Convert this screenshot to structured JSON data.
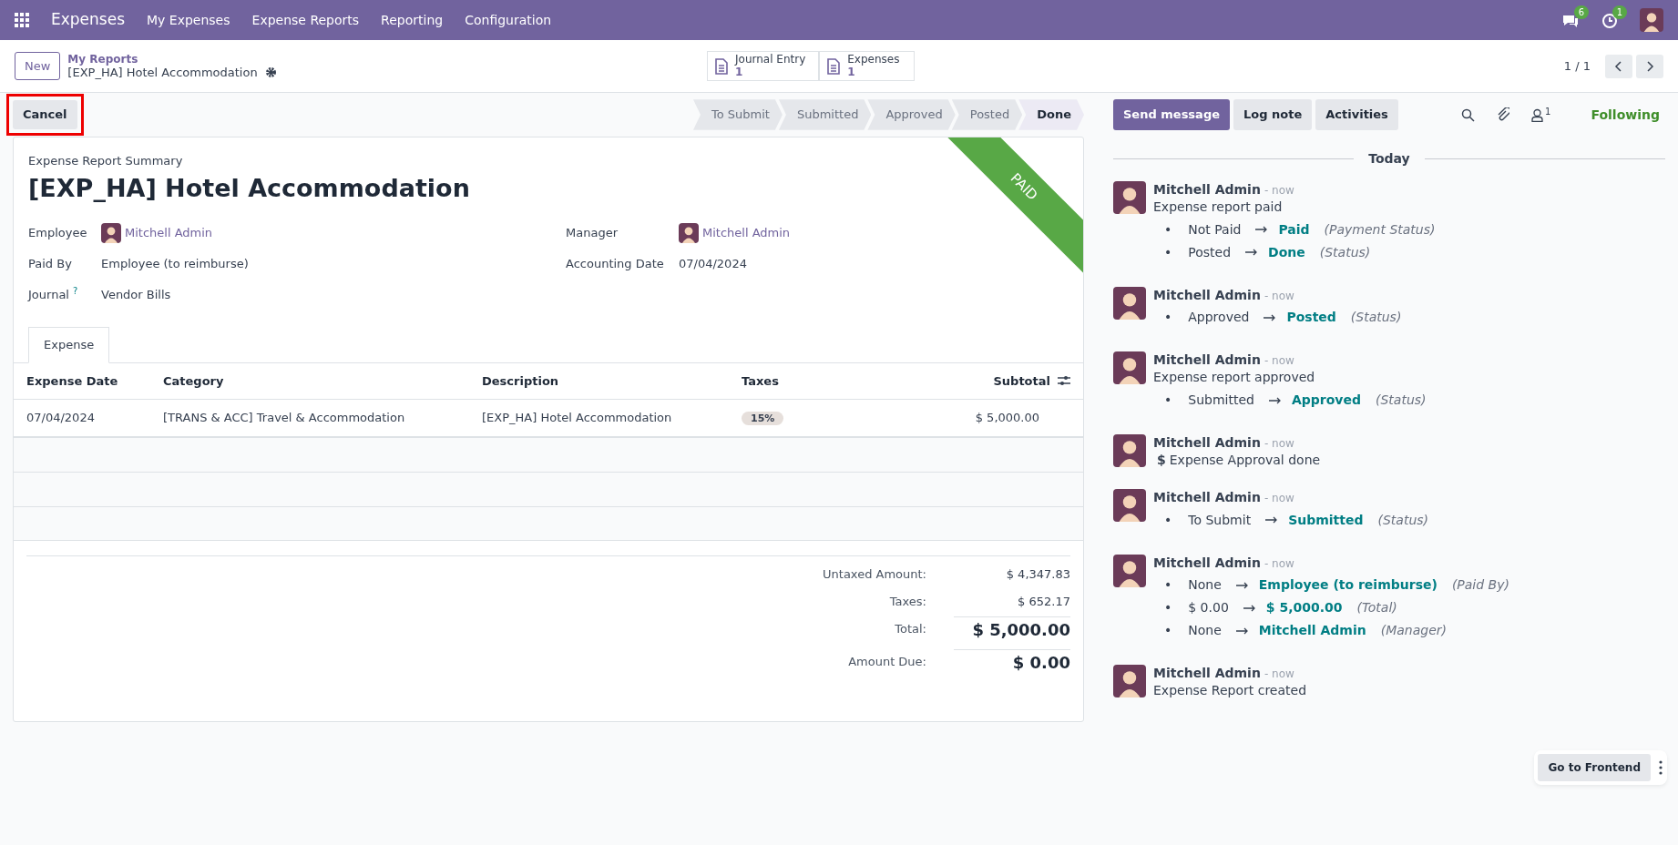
{
  "navbar": {
    "app": "Expenses",
    "menu": [
      "My Expenses",
      "Expense Reports",
      "Reporting",
      "Configuration"
    ],
    "messages_count": "6",
    "activities_count": "1"
  },
  "control_panel": {
    "new_button": "New",
    "breadcrumb": "My Reports",
    "record": "[EXP_HA] Hotel Accommodation",
    "smart_buttons": [
      {
        "label": "Journal Entry",
        "count": "1"
      },
      {
        "label": "Expenses",
        "count": "1"
      }
    ],
    "pager": "1 / 1"
  },
  "actions": [
    {
      "label": "Cancel",
      "highlighted": true
    }
  ],
  "stages": [
    {
      "label": "To Submit",
      "selected": false
    },
    {
      "label": "Submitted",
      "selected": false
    },
    {
      "label": "Approved",
      "selected": false
    },
    {
      "label": "Posted",
      "selected": false
    },
    {
      "label": "Done",
      "selected": true
    }
  ],
  "form": {
    "ribbon": "PAID",
    "subtitle": "Expense Report Summary",
    "title": "[EXP_HA] Hotel Accommodation",
    "left_fields": [
      {
        "label": "Employee",
        "value": "Mitchell Admin",
        "kind": "user"
      },
      {
        "label": "Paid By",
        "value": "Employee (to reimburse)",
        "kind": "text"
      },
      {
        "label": "Journal",
        "help": "?",
        "value": "Vendor Bills",
        "kind": "text"
      }
    ],
    "right_fields": [
      {
        "label": "Manager",
        "value": "Mitchell Admin",
        "kind": "user"
      },
      {
        "label": "Accounting Date",
        "value": "07/04/2024",
        "kind": "text"
      }
    ],
    "tabs": [
      {
        "label": "Expense",
        "selected": true
      }
    ],
    "table": {
      "columns": [
        "Expense Date",
        "Category",
        "Description",
        "Taxes",
        "Subtotal"
      ],
      "rows": [
        {
          "cells": [
            "07/04/2024",
            "[TRANS & ACC] Travel & Accommodation",
            "[EXP_HA] Hotel Accommodation",
            "15%",
            "$ 5,000.00"
          ]
        }
      ]
    },
    "totals": [
      {
        "label": "Untaxed Amount:",
        "value": "$ 4,347.83",
        "kind": "plain"
      },
      {
        "label": "Taxes:",
        "value": "$ 652.17",
        "kind": "plain"
      },
      {
        "label": "Total:",
        "value": "$ 5,000.00",
        "kind": "big"
      },
      {
        "label": "Amount Due:",
        "value": "$ 0.00",
        "kind": "big"
      }
    ]
  },
  "chatter": {
    "buttons": [
      {
        "label": "Send message",
        "selected": true
      },
      {
        "label": "Log note",
        "selected": false
      },
      {
        "label": "Activities",
        "selected": false
      }
    ],
    "followers_count": "1",
    "following": "Following",
    "date": "Today",
    "messages": [
      {
        "author": "Mitchell Admin",
        "time": "- now",
        "body": "Expense report paid",
        "changes": [
          {
            "bullet": "•",
            "old": "Not Paid",
            "new": "Paid",
            "field": "(Payment Status)"
          },
          {
            "bullet": "•",
            "old": "Posted",
            "new": "Done",
            "field": "(Status)"
          }
        ]
      },
      {
        "author": "Mitchell Admin",
        "time": "- now",
        "changes": [
          {
            "bullet": "•",
            "old": "Approved",
            "new": "Posted",
            "field": "(Status)"
          }
        ]
      },
      {
        "author": "Mitchell Admin",
        "time": "- now",
        "body": "Expense report approved",
        "changes": [
          {
            "bullet": "•",
            "old": "Submitted",
            "new": "Approved",
            "field": "(Status)"
          }
        ]
      },
      {
        "author": "Mitchell Admin",
        "time": "- now",
        "activity": "$",
        "body": "Expense Approval done"
      },
      {
        "author": "Mitchell Admin",
        "time": "- now",
        "changes": [
          {
            "bullet": "•",
            "old": "To Submit",
            "new": "Submitted",
            "field": "(Status)"
          }
        ]
      },
      {
        "author": "Mitchell Admin",
        "time": "- now",
        "changes": [
          {
            "bullet": "•",
            "old": "None",
            "new": "Employee (to reimburse)",
            "field": "(Paid By)"
          },
          {
            "bullet": "•",
            "old": "$ 0.00",
            "new": "$ 5,000.00",
            "field": "(Total)"
          },
          {
            "bullet": "•",
            "old": "None",
            "new": "Mitchell Admin",
            "field": "(Manager)"
          }
        ]
      },
      {
        "author": "Mitchell Admin",
        "time": "- now",
        "body": "Expense Report created"
      }
    ]
  },
  "frontend": {
    "label": "Go to Frontend"
  }
}
